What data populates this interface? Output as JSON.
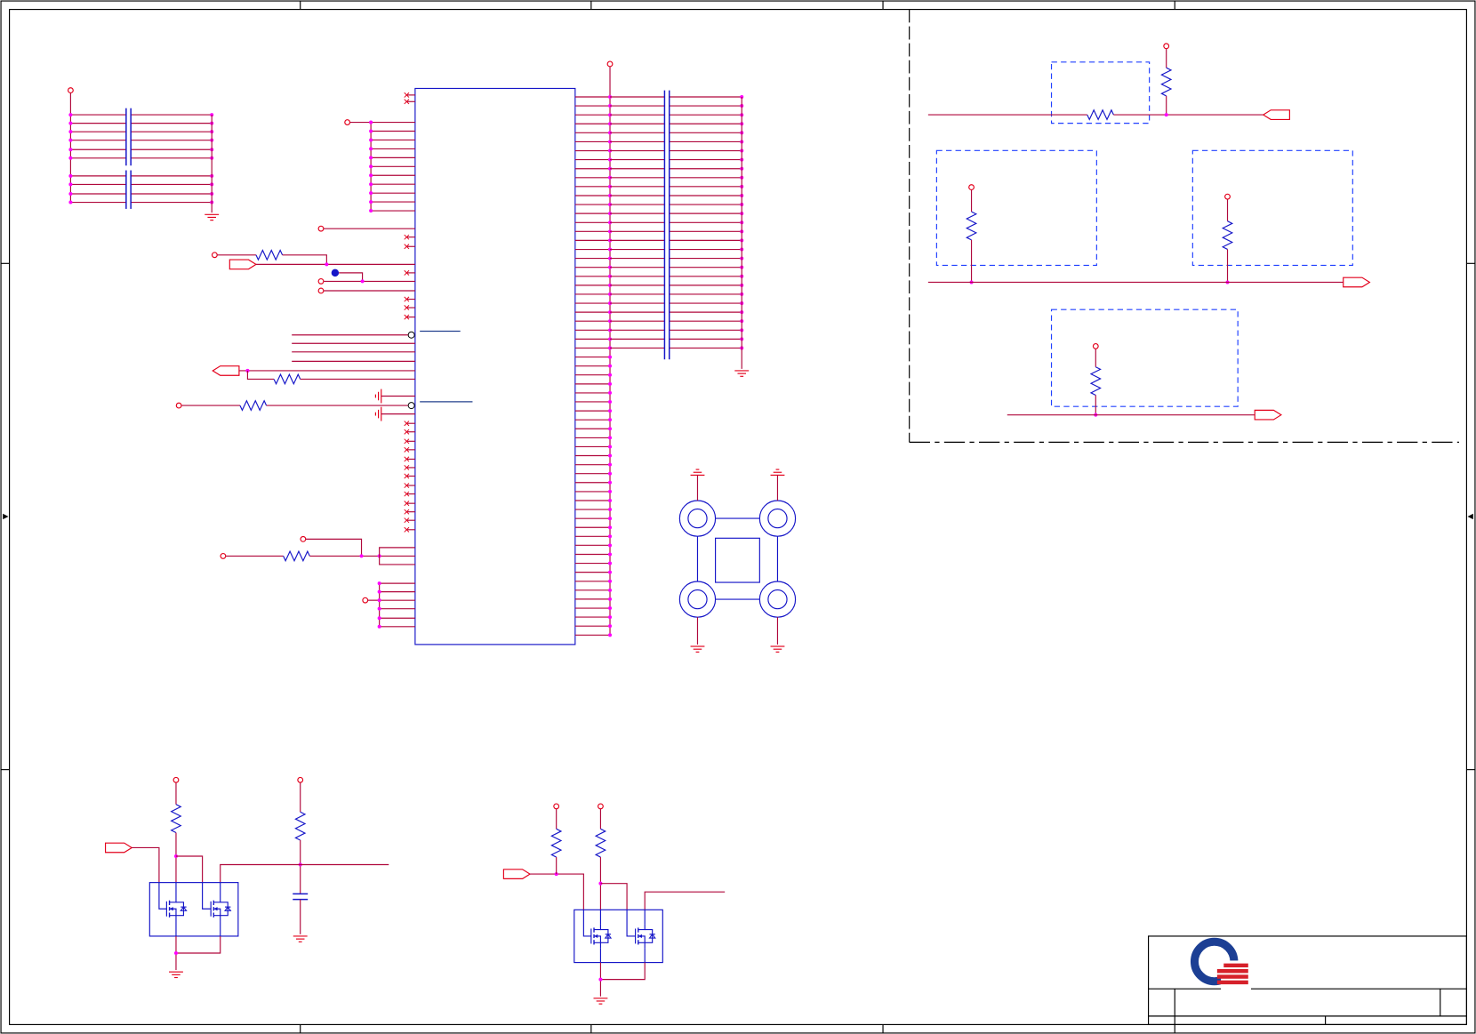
{
  "colors": {
    "wire": "#b0083c",
    "symbol": "#e3001b",
    "component": "#1616c8",
    "region": "#2040ff",
    "junction": "#ff00ff",
    "frame": "#000000",
    "annotation": "#23408e",
    "logo_blue": "#1c3f94",
    "logo_red": "#d6202a",
    "background": "#ffffff"
  },
  "icons": {
    "power": "power-rail-icon",
    "ground": "ground-icon",
    "resistor": "resistor-icon",
    "capacitor": "capacitor-icon",
    "mosfet": "mosfet-icon",
    "connector": "off-page-connector-icon",
    "no_connect": "no-connect-icon",
    "mounting_hole": "mounting-hole-icon",
    "test_point": "test-point-icon",
    "logo": "company-logo-icon"
  }
}
